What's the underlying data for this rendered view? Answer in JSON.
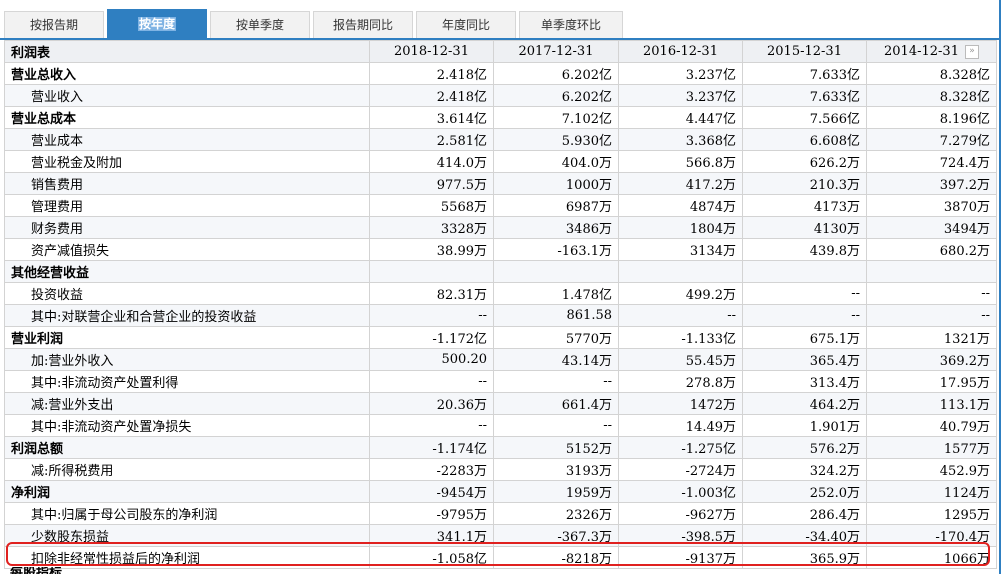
{
  "tabs": [
    "按报告期",
    "按年度",
    "按单季度",
    "报告期同比",
    "年度同比",
    "单季度环比"
  ],
  "active_tab": "按年度",
  "table": {
    "header_label": "利润表",
    "columns": [
      "2018-12-31",
      "2017-12-31",
      "2016-12-31",
      "2015-12-31",
      "2014-12-31"
    ],
    "next_icon": "»",
    "rows": [
      {
        "label": "营业总收入",
        "section": true,
        "values": [
          "2.418亿",
          "6.202亿",
          "3.237亿",
          "7.633亿",
          "8.328亿"
        ]
      },
      {
        "label": "营业收入",
        "values": [
          "2.418亿",
          "6.202亿",
          "3.237亿",
          "7.633亿",
          "8.328亿"
        ]
      },
      {
        "label": "营业总成本",
        "section": true,
        "values": [
          "3.614亿",
          "7.102亿",
          "4.447亿",
          "7.566亿",
          "8.196亿"
        ]
      },
      {
        "label": "营业成本",
        "values": [
          "2.581亿",
          "5.930亿",
          "3.368亿",
          "6.608亿",
          "7.279亿"
        ]
      },
      {
        "label": "营业税金及附加",
        "values": [
          "414.0万",
          "404.0万",
          "566.8万",
          "626.2万",
          "724.4万"
        ]
      },
      {
        "label": "销售费用",
        "values": [
          "977.5万",
          "1000万",
          "417.2万",
          "210.3万",
          "397.2万"
        ]
      },
      {
        "label": "管理费用",
        "values": [
          "5568万",
          "6987万",
          "4874万",
          "4173万",
          "3870万"
        ]
      },
      {
        "label": "财务费用",
        "values": [
          "3328万",
          "3486万",
          "1804万",
          "4130万",
          "3494万"
        ]
      },
      {
        "label": "资产减值损失",
        "values": [
          "38.99万",
          "-163.1万",
          "3134万",
          "439.8万",
          "680.2万"
        ]
      },
      {
        "label": "其他经营收益",
        "section": true,
        "values": [
          "",
          "",
          "",
          "",
          ""
        ]
      },
      {
        "label": "投资收益",
        "values": [
          "82.31万",
          "1.478亿",
          "499.2万",
          "--",
          "--"
        ]
      },
      {
        "label": "其中:对联营企业和合营企业的投资收益",
        "values": [
          "--",
          "861.58",
          "--",
          "--",
          "--"
        ]
      },
      {
        "label": "营业利润",
        "section": true,
        "values": [
          "-1.172亿",
          "5770万",
          "-1.133亿",
          "675.1万",
          "1321万"
        ]
      },
      {
        "label": "加:营业外收入",
        "values": [
          "500.20",
          "43.14万",
          "55.45万",
          "365.4万",
          "369.2万"
        ]
      },
      {
        "label": "其中:非流动资产处置利得",
        "values": [
          "--",
          "--",
          "278.8万",
          "313.4万",
          "17.95万"
        ]
      },
      {
        "label": "减:营业外支出",
        "values": [
          "20.36万",
          "661.4万",
          "1472万",
          "464.2万",
          "113.1万"
        ]
      },
      {
        "label": "其中:非流动资产处置净损失",
        "values": [
          "--",
          "--",
          "14.49万",
          "1.901万",
          "40.79万"
        ]
      },
      {
        "label": "利润总额",
        "section": true,
        "values": [
          "-1.174亿",
          "5152万",
          "-1.275亿",
          "576.2万",
          "1577万"
        ]
      },
      {
        "label": "减:所得税费用",
        "values": [
          "-2283万",
          "3193万",
          "-2724万",
          "324.2万",
          "452.9万"
        ]
      },
      {
        "label": "净利润",
        "section": true,
        "values": [
          "-9454万",
          "1959万",
          "-1.003亿",
          "252.0万",
          "1124万"
        ]
      },
      {
        "label": "其中:归属于母公司股东的净利润",
        "values": [
          "-9795万",
          "2326万",
          "-9627万",
          "286.4万",
          "1295万"
        ]
      },
      {
        "label": "少数股东损益",
        "values": [
          "341.1万",
          "-367.3万",
          "-398.5万",
          "-34.40万",
          "-170.4万"
        ]
      },
      {
        "label": "扣除非经常性损益后的净利润",
        "values": [
          "-1.058亿",
          "-8218万",
          "-9137万",
          "365.9万",
          "1066万"
        ]
      }
    ],
    "cut_off_label": "每股指标"
  }
}
